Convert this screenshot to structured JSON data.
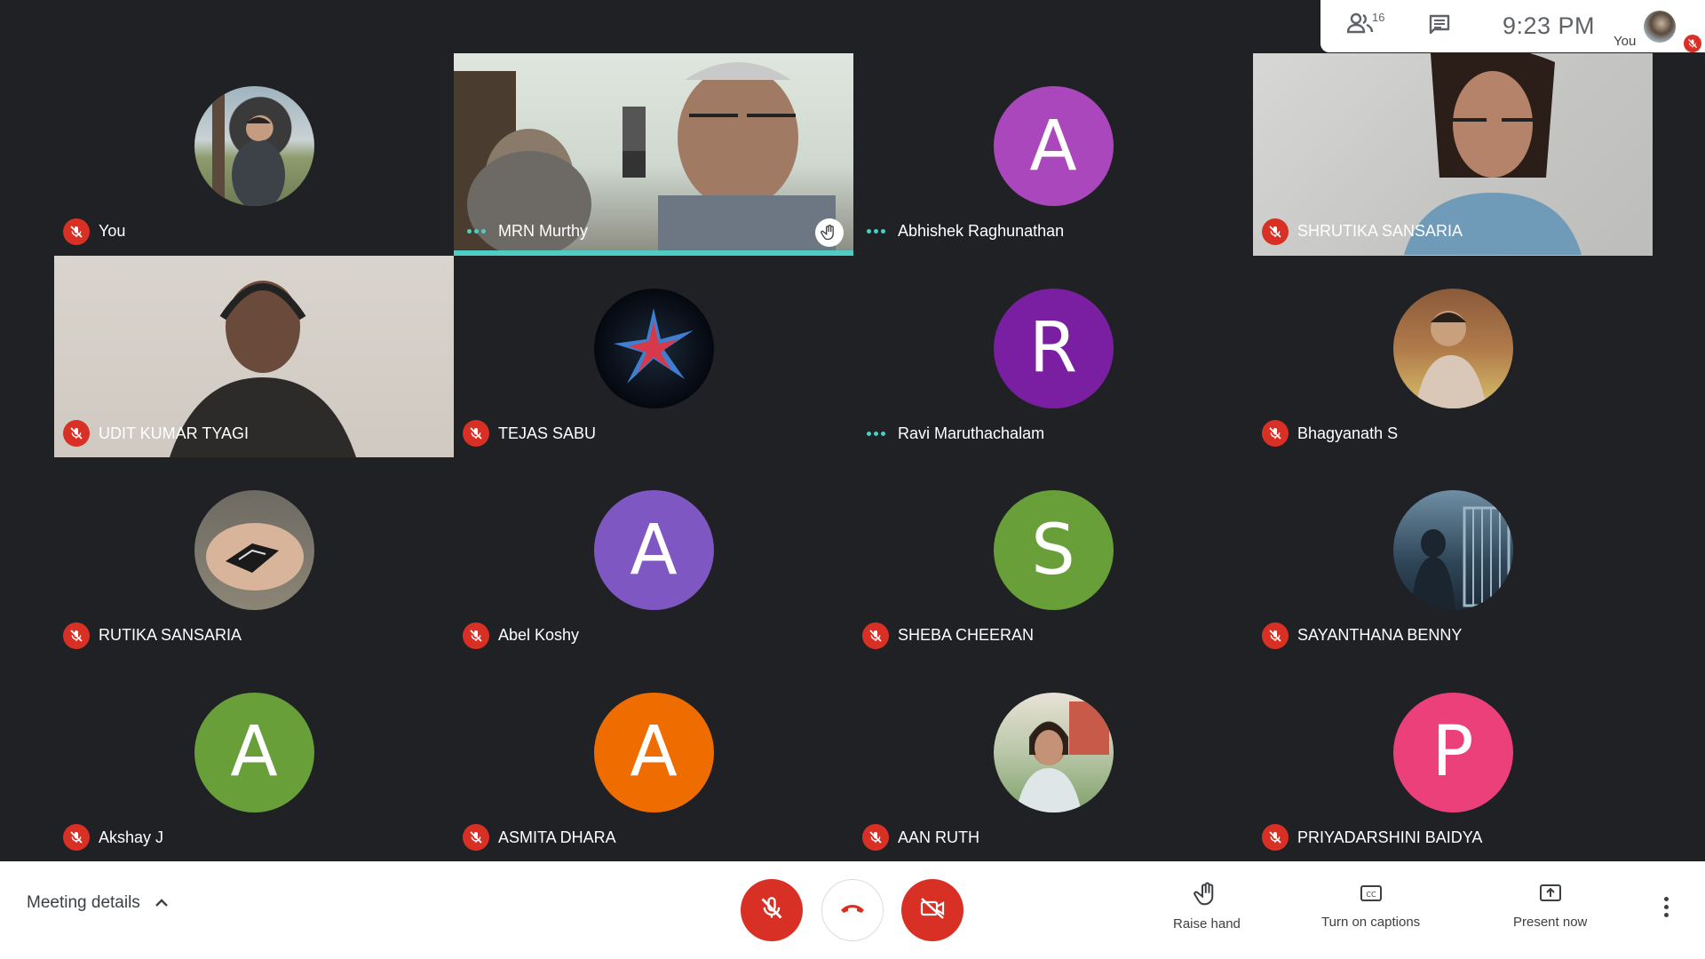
{
  "topbar": {
    "participant_count": "16",
    "time": "9:23  PM",
    "self_label": "You"
  },
  "tiles": [
    {
      "name": "You",
      "status": "muted",
      "avatar": "photo"
    },
    {
      "name": "MRN Murthy",
      "status": "speaking",
      "avatar": "video",
      "hand_raised": true
    },
    {
      "name": "Abhishek Raghunathan",
      "status": "dots",
      "avatar": "letter",
      "letter": "A",
      "color": "#ab47bc"
    },
    {
      "name": "SHRUTIKA SANSARIA",
      "status": "muted",
      "avatar": "video"
    },
    {
      "name": "UDIT KUMAR TYAGI",
      "status": "muted",
      "avatar": "video"
    },
    {
      "name": "TEJAS SABU",
      "status": "muted",
      "avatar": "photo"
    },
    {
      "name": "Ravi Maruthachalam",
      "status": "dots",
      "avatar": "letter",
      "letter": "R",
      "color": "#7b1fa2"
    },
    {
      "name": "Bhagyanath S",
      "status": "muted",
      "avatar": "photo"
    },
    {
      "name": "RUTIKA SANSARIA",
      "status": "muted",
      "avatar": "photo"
    },
    {
      "name": "Abel Koshy",
      "status": "muted",
      "avatar": "letter",
      "letter": "A",
      "color": "#7e57c2"
    },
    {
      "name": "SHEBA CHEERAN",
      "status": "muted",
      "avatar": "letter",
      "letter": "S",
      "color": "#689f38"
    },
    {
      "name": "SAYANTHANA BENNY",
      "status": "muted",
      "avatar": "photo"
    },
    {
      "name": "Akshay J",
      "status": "muted",
      "avatar": "letter",
      "letter": "A",
      "color": "#689f38"
    },
    {
      "name": "ASMITA DHARA",
      "status": "muted",
      "avatar": "letter",
      "letter": "A",
      "color": "#ef6c00"
    },
    {
      "name": "AAN RUTH",
      "status": "muted",
      "avatar": "photo"
    },
    {
      "name": "PRIYADARSHINI BAIDYA",
      "status": "muted",
      "avatar": "letter",
      "letter": "P",
      "color": "#ec407a"
    }
  ],
  "bottombar": {
    "meeting_details": "Meeting details",
    "raise_hand": "Raise hand",
    "captions": "Turn on captions",
    "present": "Present now"
  },
  "icons": [
    "people-icon",
    "chat-icon",
    "mic-off-icon",
    "hangup-icon",
    "camera-off-icon",
    "hand-icon",
    "cc-icon",
    "present-icon",
    "more-vert-icon",
    "chevron-up-icon"
  ],
  "colors": {
    "danger": "#d93025",
    "speaking": "#4ecdc4",
    "tile_bg": "#202124"
  }
}
